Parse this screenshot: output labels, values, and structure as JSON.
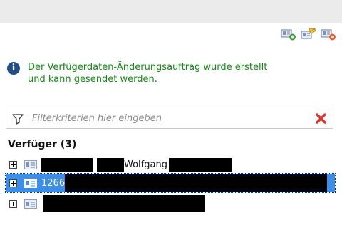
{
  "toolbar": {
    "icons": [
      "add-person-card-icon",
      "edit-person-card-icon",
      "delete-person-card-icon"
    ]
  },
  "message": {
    "type": "info",
    "text": "Der Verfügerdaten-Änderungsauftrag wurde erstellt\nund kann gesendet werden.",
    "color": "#138a13"
  },
  "filter": {
    "placeholder": "Filterkriterien hier eingeben",
    "value": ""
  },
  "section": {
    "title": "Verfüger (3)"
  },
  "rows": [
    {
      "text": "Wolfgang",
      "selected": false
    },
    {
      "text": "1266",
      "selected": true
    },
    {
      "text": "",
      "selected": false
    }
  ],
  "colors": {
    "selection": "#3d8ee6",
    "info_icon": "#1f4f86",
    "clear_icon": "#e0322d"
  }
}
